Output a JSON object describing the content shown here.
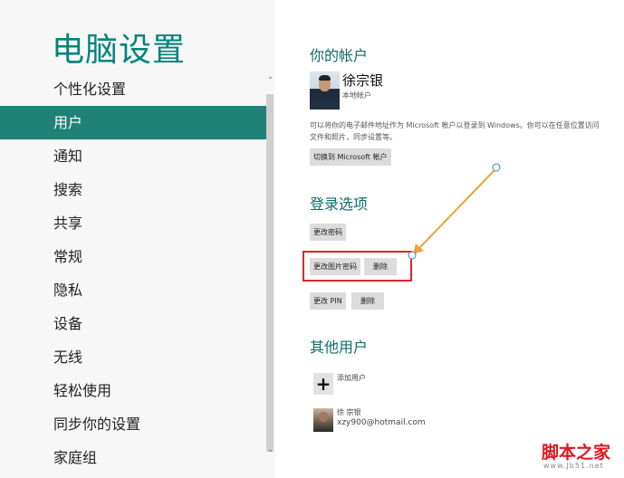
{
  "app": {
    "title": "电脑设置"
  },
  "nav": {
    "items": [
      {
        "label": "个性化设置"
      },
      {
        "label": "用户",
        "selected": true
      },
      {
        "label": "通知"
      },
      {
        "label": "搜索"
      },
      {
        "label": "共享"
      },
      {
        "label": "常规"
      },
      {
        "label": "隐私"
      },
      {
        "label": "设备"
      },
      {
        "label": "无线"
      },
      {
        "label": "轻松使用"
      },
      {
        "label": "同步你的设置"
      },
      {
        "label": "家庭组"
      }
    ],
    "scroll_up": "˄",
    "scroll_down": "˅"
  },
  "account": {
    "section_title": "你的帐户",
    "user_name": "徐宗银",
    "user_type": "本地帐户",
    "description": "可以将你的电子邮件地址作为 Microsoft 帐户以登录到 Windows。你可以在任意位置访问文件和照片，同步设置等。",
    "switch_button": "切换到 Microsoft 帐户"
  },
  "signin": {
    "section_title": "登录选项",
    "change_password": "更改密码",
    "change_picture_password": "更改图片密码",
    "delete_picture_password": "删除",
    "change_pin": "更改 PIN",
    "delete_pin": "删除"
  },
  "other_users": {
    "section_title": "其他用户",
    "add_user_icon": "+",
    "add_user_label": "添加用户",
    "users": [
      {
        "name": "徐 宗银",
        "email": "xzy900@hotmail.com"
      }
    ]
  },
  "watermark": {
    "text": "脚本之家",
    "url": "www.Jb51.net"
  },
  "colors": {
    "accent": "#1f8178",
    "title": "#00857a",
    "highlight": "#d8262c",
    "arrow": "#f0a040"
  }
}
